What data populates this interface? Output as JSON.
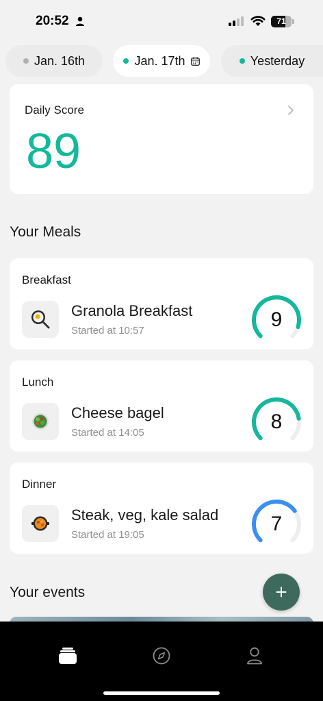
{
  "status_bar": {
    "time": "20:52",
    "battery": "71",
    "battery_level": 0.71
  },
  "date_tabs": [
    {
      "label": "Jan. 16th",
      "dot_color": "#b0b0b0",
      "active": false
    },
    {
      "label": "Jan. 17th",
      "dot_color": "#14b89a",
      "active": true
    },
    {
      "label": "Yesterday",
      "dot_color": "#14b89a",
      "active": false
    }
  ],
  "daily_score": {
    "label": "Daily Score",
    "value": "89",
    "color": "#14b89a"
  },
  "meals_section": {
    "title": "Your Meals"
  },
  "meals": [
    {
      "label": "Breakfast",
      "name": "Granola Breakfast",
      "time": "Started at 10:57",
      "score": "9",
      "score_fraction": 0.9,
      "ring_color": "#14b89a",
      "icon": "frying-pan-egg-icon"
    },
    {
      "label": "Lunch",
      "name": "Cheese bagel",
      "time": "Started at 14:05",
      "score": "8",
      "score_fraction": 0.8,
      "ring_color": "#14b89a",
      "icon": "salad-bowl-icon"
    },
    {
      "label": "Dinner",
      "name": "Steak, veg, kale salad",
      "time": "Started at 19:05",
      "score": "7",
      "score_fraction": 0.7,
      "ring_color": "#3b8ff0",
      "icon": "paella-pan-icon"
    }
  ],
  "events_section": {
    "title": "Your events"
  },
  "fab": {
    "icon": "plus-icon"
  },
  "bottom_nav": [
    {
      "icon": "cards-icon",
      "active": true
    },
    {
      "icon": "compass-icon",
      "active": false
    },
    {
      "icon": "profile-icon",
      "active": false
    }
  ],
  "colors": {
    "accent_green": "#14b89a",
    "accent_blue": "#3b8ff0",
    "fab": "#3e6a5e"
  }
}
